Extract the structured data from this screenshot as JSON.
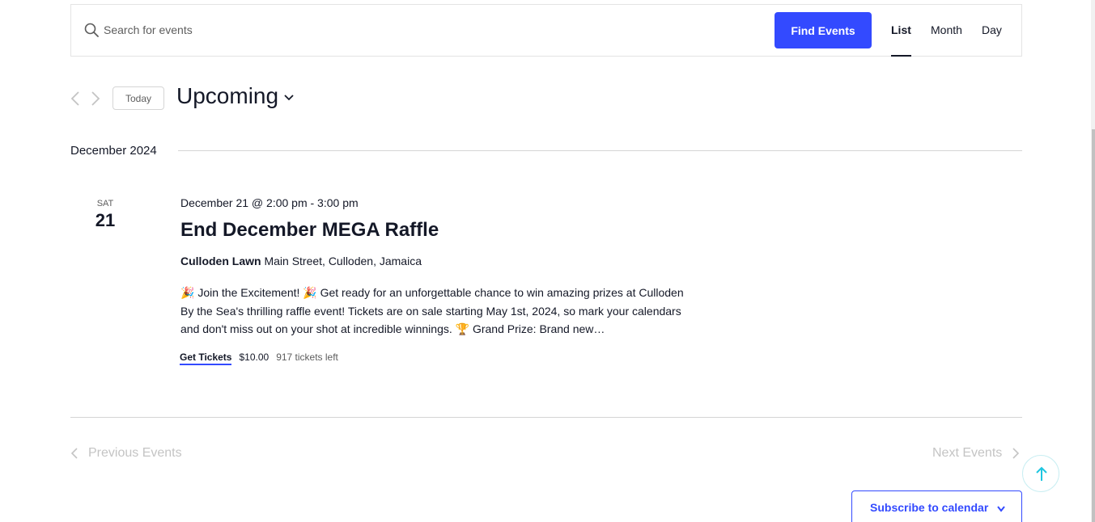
{
  "search": {
    "placeholder": "Search for events",
    "find_label": "Find Events"
  },
  "views": {
    "list": "List",
    "month": "Month",
    "day": "Day",
    "active": "List"
  },
  "nav": {
    "today_label": "Today",
    "range_label": "Upcoming"
  },
  "month_separator": "December 2024",
  "event": {
    "weekday": "SAT",
    "day": "21",
    "datetime": "December 21 @ 2:00 pm - 3:00 pm",
    "title": "End December MEGA Raffle",
    "venue_name": "Culloden Lawn",
    "venue_address": "Main Street, Culloden, Jamaica",
    "description": "🎉 Join the Excitement! 🎉 Get ready for an unforgettable chance to win amazing prizes at Culloden By the Sea's thrilling raffle event! Tickets are on sale starting May 1st, 2024, so mark your calendars and don't miss out on your shot at incredible winnings. 🏆 Grand Prize: Brand new…",
    "tickets_label": "Get Tickets",
    "price": "$10.00",
    "tickets_left": "917 tickets left"
  },
  "pagination": {
    "previous": "Previous Events",
    "next": "Next Events"
  },
  "subscribe_label": "Subscribe to calendar",
  "colors": {
    "accent": "#334aff",
    "text": "#141827",
    "muted": "#5d5d5d",
    "disabled": "#c4c4c4",
    "scroll_top_accent": "#1ec6e0"
  },
  "icons": [
    "search-icon",
    "chevron-left-icon",
    "chevron-right-icon",
    "chevron-down-icon",
    "arrow-up-icon"
  ]
}
